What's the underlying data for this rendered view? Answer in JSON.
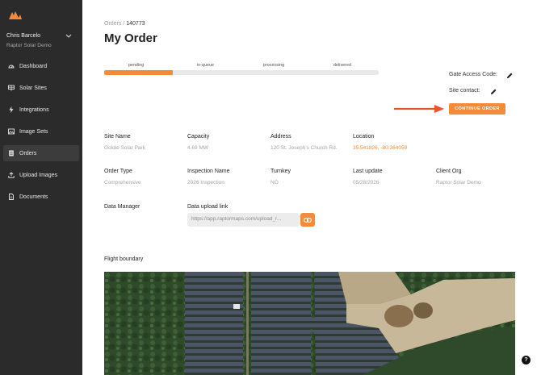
{
  "user": {
    "name": "Chris Barcelo",
    "org": "Raptor Solar Demo"
  },
  "nav": [
    {
      "label": "Dashboard",
      "icon": "dashboard-icon",
      "active": false
    },
    {
      "label": "Solar Sites",
      "icon": "solar-panel-icon",
      "active": false
    },
    {
      "label": "Integrations",
      "icon": "lightning-icon",
      "active": false
    },
    {
      "label": "Image Sets",
      "icon": "image-icon",
      "active": false
    },
    {
      "label": "Orders",
      "icon": "document-icon",
      "active": true
    },
    {
      "label": "Upload Images",
      "icon": "upload-icon",
      "active": false
    },
    {
      "label": "Documents",
      "icon": "file-icon",
      "active": false
    }
  ],
  "breadcrumb": {
    "parent": "Orders",
    "separator": " / ",
    "current": "140773"
  },
  "page_title": "My Order",
  "progress": {
    "stages": [
      "pending",
      "in-queue",
      "processing",
      "delivered"
    ],
    "fill_fraction": 0.25
  },
  "gate_access_label": "Gate Access Code:",
  "site_contact_label": "Site contact:",
  "continue_label": "CONTINUE ORDER",
  "details": {
    "site_name": {
      "label": "Site Name",
      "value": "Goldie Solar Park"
    },
    "capacity": {
      "label": "Capacity",
      "value": "4.69 MW"
    },
    "address": {
      "label": "Address",
      "value": "120 St. Joseph's Church Rd."
    },
    "location": {
      "label": "Location",
      "value": "35.541826, -80.364059"
    },
    "order_type": {
      "label": "Order Type",
      "value": "Comprehensive"
    },
    "inspection_name": {
      "label": "Inspection Name",
      "value": "2026 Inspection"
    },
    "turnkey": {
      "label": "Turnkey",
      "value": "NO"
    },
    "last_update": {
      "label": "Last update",
      "value": "05/28/2026"
    },
    "client_org": {
      "label": "Client Org",
      "value": "Raptor Solar Demo"
    },
    "data_manager": {
      "label": "Data Manager"
    },
    "data_upload": {
      "label": "Data upload link",
      "value": "https://app.raptormaps.com/upload_r..."
    }
  },
  "flight_boundary_label": "Flight boundary",
  "help_label": "?",
  "colors": {
    "accent": "#f58a38",
    "sidebar": "#2b2b2b",
    "arrow": "#e8562a"
  }
}
